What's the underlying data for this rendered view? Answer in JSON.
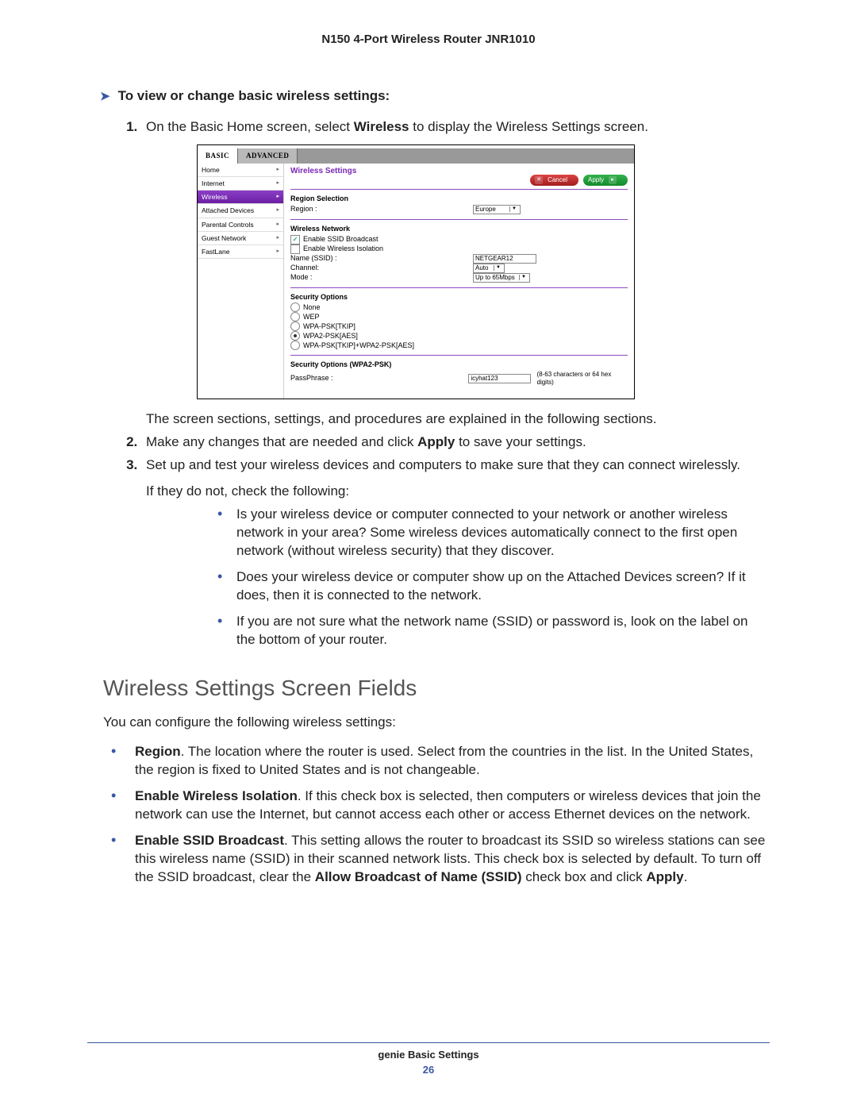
{
  "header": {
    "title": "N150 4-Port Wireless Router JNR1010"
  },
  "procedure": {
    "heading": "To view or change basic wireless settings:",
    "step1_pre": "On the Basic Home screen, select ",
    "step1_bold": "Wireless",
    "step1_post": " to display the Wireless Settings screen.",
    "post_screenshot": "The screen sections, settings, and procedures are explained in the following sections.",
    "step2_pre": "Make any changes that are needed and click ",
    "step2_bold": "Apply",
    "step2_post": " to save your settings.",
    "step3": "Set up and test your wireless devices and computers to make sure that they can connect wirelessly.",
    "check_intro": "If they do not, check the following:",
    "check_bullets": [
      "Is your wireless device or computer connected to your network or another wireless network in your area? Some wireless devices automatically connect to the first open network (without wireless security) that they discover.",
      "Does your wireless device or computer show up on the Attached Devices screen? If it does, then it is connected to the network.",
      "If you are not sure what the network name (SSID) or password is, look on the label on the bottom of your router."
    ]
  },
  "section": {
    "heading": "Wireless Settings Screen Fields",
    "intro": "You can configure the following wireless settings:",
    "items": [
      {
        "bold": "Region",
        "rest": ". The location where the router is used. Select from the countries in the list. In the United States, the region is fixed to United States and is not changeable."
      },
      {
        "bold": "Enable Wireless Isolation",
        "rest": ". If this check box is selected, then computers or wireless devices that join the network can use the Internet, but cannot access each other or access Ethernet devices on the network."
      },
      {
        "bold": "Enable SSID Broadcast",
        "rest_pre": ". This setting allows the router to broadcast its SSID so wireless stations can see this wireless name (SSID) in their scanned network lists. This check box is selected by default. To turn off the SSID broadcast, clear the ",
        "bold2": "Allow Broadcast of Name (SSID)",
        "rest_mid": " check box and click ",
        "bold3": "Apply",
        "rest_post": "."
      }
    ]
  },
  "screenshot": {
    "tabs": {
      "basic": "BASIC",
      "advanced": "ADVANCED"
    },
    "nav": [
      {
        "label": "Home",
        "selected": false
      },
      {
        "label": "Internet",
        "selected": false
      },
      {
        "label": "Wireless",
        "selected": true
      },
      {
        "label": "Attached Devices",
        "selected": false
      },
      {
        "label": "Parental Controls",
        "selected": false
      },
      {
        "label": "Guest Network",
        "selected": false
      },
      {
        "label": "FastLane",
        "selected": false
      }
    ],
    "pane_title": "Wireless Settings",
    "buttons": {
      "cancel": "Cancel",
      "apply": "Apply"
    },
    "region": {
      "heading": "Region Selection",
      "label": "Region :",
      "value": "Europe"
    },
    "network": {
      "heading": "Wireless Network",
      "ssid_broadcast": {
        "label": "Enable SSID Broadcast",
        "checked": true
      },
      "isolation": {
        "label": "Enable Wireless Isolation",
        "checked": false
      },
      "name_label": "Name (SSID) :",
      "name_value": "NETGEAR12",
      "channel_label": "Channel:",
      "channel_value": "Auto",
      "mode_label": "Mode :",
      "mode_value": "Up to 65Mbps"
    },
    "security": {
      "heading": "Security Options",
      "options": [
        {
          "label": "None",
          "selected": false
        },
        {
          "label": "WEP",
          "selected": false
        },
        {
          "label": "WPA-PSK[TKIP]",
          "selected": false
        },
        {
          "label": "WPA2-PSK[AES]",
          "selected": true
        },
        {
          "label": "WPA-PSK[TKIP]+WPA2-PSK[AES]",
          "selected": false
        }
      ]
    },
    "passphrase": {
      "heading": "Security Options (WPA2-PSK)",
      "label": "PassPhrase :",
      "value": "icyhat123",
      "note": "(8-63 characters or 64 hex digits)"
    }
  },
  "footer": {
    "chapter": "genie Basic Settings",
    "page": "26"
  }
}
